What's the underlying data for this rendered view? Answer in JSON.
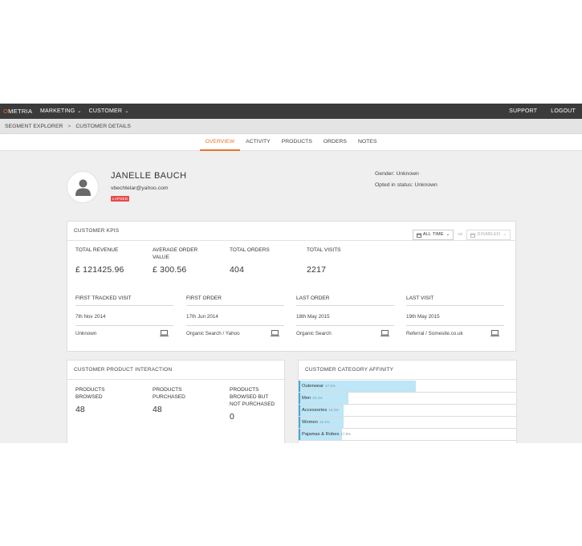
{
  "topnav": {
    "logo_mark": "O",
    "logo_text": "METRIA",
    "menus": [
      {
        "label": "MARKETING",
        "chevron": "⌄"
      },
      {
        "label": "CUSTOMER",
        "chevron": "⌄"
      }
    ],
    "support": "SUPPORT",
    "logout": "LOGOUT"
  },
  "breadcrumb": {
    "items": [
      "SEGMENT EXPLORER",
      "CUSTOMER DETAILS"
    ],
    "separator": ">"
  },
  "tabs": [
    {
      "label": "OVERVIEW",
      "active": true
    },
    {
      "label": "ACTIVITY",
      "active": false
    },
    {
      "label": "PRODUCTS",
      "active": false
    },
    {
      "label": "ORDERS",
      "active": false
    },
    {
      "label": "NOTES",
      "active": false
    }
  ],
  "profile": {
    "icon": "user-silhouette-icon",
    "name": "JANELLE BAUCH",
    "email": "vbechtelar@yahoo.com",
    "status_badge": "LAPSED",
    "gender": "Gender: Unknown",
    "opted_in": "Opted in status: Unknown"
  },
  "kpis": {
    "title": "CUSTOMER KPIS",
    "filter_time": "ALL TIME",
    "vs_label": "vs",
    "filter_compare": "DISABLED",
    "metrics": [
      {
        "label": "TOTAL REVENUE",
        "value": "£ 121425.96"
      },
      {
        "label": "AVERAGE ORDER VALUE",
        "value": "£ 300.56"
      },
      {
        "label": "TOTAL ORDERS",
        "value": "404"
      },
      {
        "label": "TOTAL VISITS",
        "value": "2217"
      }
    ],
    "tiles": [
      {
        "label": "FIRST TRACKED VISIT",
        "date": "7th Nov 2014",
        "source": "Unknown",
        "icon": "laptop-icon"
      },
      {
        "label": "FIRST ORDER",
        "date": "17th Jun 2014",
        "source": "Organic Search / Yahoo",
        "icon": "laptop-icon"
      },
      {
        "label": "LAST ORDER",
        "date": "18th May 2015",
        "source": "Organic Search",
        "icon": "laptop-icon"
      },
      {
        "label": "LAST VISIT",
        "date": "19th May 2015",
        "source": "Referral / Somesite.co.uk",
        "icon": "laptop-icon"
      }
    ]
  },
  "interaction": {
    "title": "CUSTOMER PRODUCT INTERACTION",
    "items": [
      {
        "label": "PRODUCTS BROWSED",
        "value": "48"
      },
      {
        "label": "PRODUCTS PURCHASED",
        "value": "48"
      },
      {
        "label": "PRODUCTS BROWSED BUT NOT PURCHASED",
        "value": "0"
      }
    ]
  },
  "affinity": {
    "title": "CUSTOMER CATEGORY AFFINITY",
    "bar_color": "#bde6f6",
    "rows": [
      {
        "label": "Outerwear",
        "pct_label": "47.5%",
        "share": 0.475
      },
      {
        "label": "Men",
        "pct_label": "20.3%",
        "share": 0.203
      },
      {
        "label": "Accessories",
        "pct_label": "18.3%",
        "share": 0.183
      },
      {
        "label": "Women",
        "pct_label": "18.1%",
        "share": 0.181
      },
      {
        "label": "Pajamas & Robes",
        "pct_label": "17.5%",
        "share": 0.175
      }
    ]
  }
}
